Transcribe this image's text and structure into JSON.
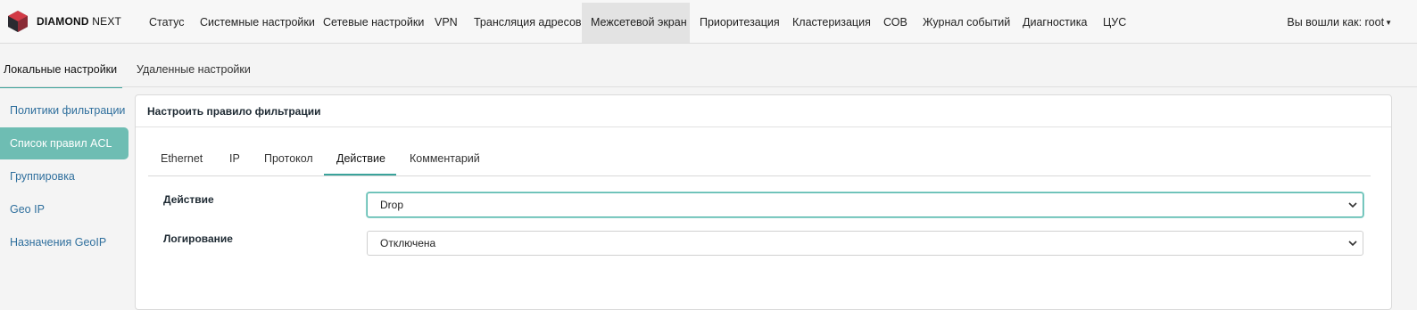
{
  "brand": {
    "name_bold": "DIAMOND",
    "name_thin": "NEXT"
  },
  "topnav": {
    "items": [
      "Статус",
      "Системные настройки",
      "Сетевые настройки",
      "VPN",
      "Трансляция адресов",
      "Межсетевой экран",
      "Приоритезация",
      "Кластеризация",
      "СОВ",
      "Журнал событий",
      "Диагностика",
      "ЦУС"
    ],
    "active_index": 5,
    "user_label": "Вы вошли как: root"
  },
  "subtabs": {
    "items": [
      "Локальные настройки",
      "Удаленные настройки"
    ],
    "active_index": 0
  },
  "sidebar": {
    "items": [
      "Политики фильтрации",
      "Список правил ACL",
      "Группировка",
      "Geo IP",
      "Назначения GeoIP"
    ],
    "active_index": 1
  },
  "card": {
    "title": "Настроить правило фильтрации",
    "tabs": [
      "Ethernet",
      "IP",
      "Протокол",
      "Действие",
      "Комментарий"
    ],
    "active_tab_index": 3,
    "form": {
      "action_label": "Действие",
      "action_value": "Drop",
      "logging_label": "Логирование",
      "logging_value": "Отключена"
    }
  },
  "colors": {
    "accent": "#6ebdb3",
    "link": "#2f6f9d",
    "tab_underline": "#3aa39b"
  },
  "icons": {
    "logo": "diamond-logo-icon",
    "select_arrow": "chevron-down-icon",
    "user_caret": "caret-down-icon"
  }
}
